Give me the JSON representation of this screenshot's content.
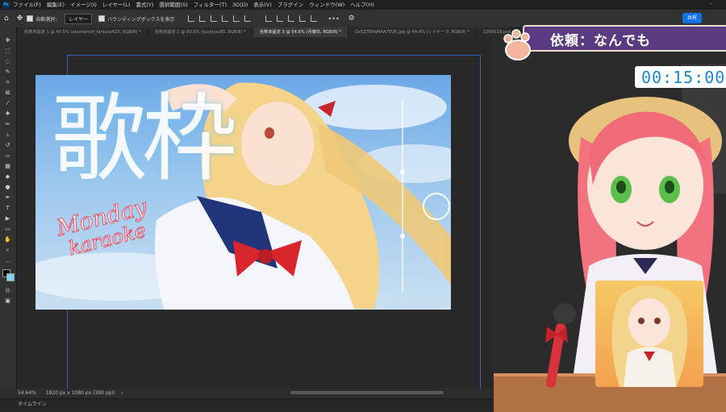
{
  "menubar": {
    "logo": "Ps",
    "items": [
      "ファイル(F)",
      "編集(E)",
      "イメージ(I)",
      "レイヤー(L)",
      "書式(Y)",
      "選択範囲(S)",
      "フィルター(T)",
      "3D(D)",
      "表示(V)",
      "プラグイン",
      "ウィンドウ(W)",
      "ヘルプ(H)"
    ]
  },
  "options": {
    "auto_select_label": "自動選択：",
    "auto_select_value": "レイヤー",
    "bbox_label": "バウンディングボックスを表示",
    "more": "•••",
    "share_label": "共有"
  },
  "tabs": [
    {
      "label": "名称未設定 1 @ 45.5% (okumomof_fantasy625, RGB/8) *",
      "active": false
    },
    {
      "label": "名称未設定 2 @ 60.6% (yuutyuu80, RGB/8) *",
      "active": false
    },
    {
      "label": "名称未設定 3 @ 54.6% (月曜日, RGB/8) *",
      "active": true
    },
    {
      "label": "GxSZTNPaMAA7EUK.jpg @ 44.4% (レイヤー 0, RGB/8) *",
      "active": false
    },
    {
      "label": "1095018.psd",
      "active": false
    }
  ],
  "artwork": {
    "title_kanji": "歌枠",
    "title_en_1": "Monday",
    "title_en_2": "karaoke"
  },
  "status": {
    "zoom": "54.64%",
    "doc_size": "1920 px x 1080 px (300 ppi)",
    "timeline": "タイムライン"
  },
  "overlay": {
    "banner_text": "依頼：なんでも",
    "timer": "00:15:00"
  },
  "colors": {
    "banner_bg": "#5a3a80",
    "timer_text": "#1f86c7",
    "share": "#1473e6"
  }
}
